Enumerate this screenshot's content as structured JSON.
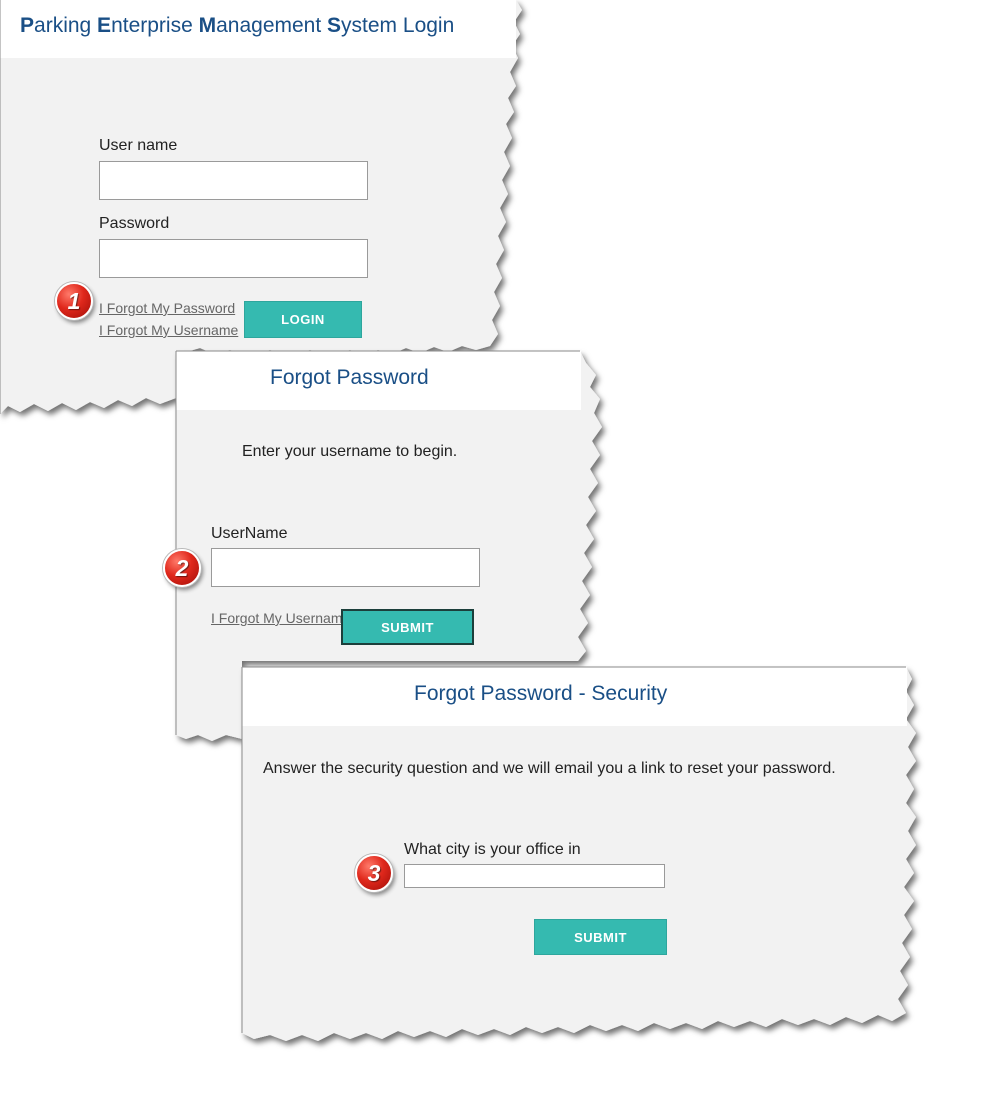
{
  "login_panel": {
    "title_parts": [
      {
        "strong": "P",
        "rest": "arking "
      },
      {
        "strong": "E",
        "rest": "nterprise "
      },
      {
        "strong": "M",
        "rest": "anagement "
      },
      {
        "strong": "S",
        "rest": "ystem Login"
      }
    ],
    "username_label": "User name",
    "username_value": "",
    "password_label": "Password",
    "password_value": "",
    "forgot_password_link": "I Forgot My Password",
    "forgot_username_link": "I Forgot My Username",
    "login_button": "LOGIN",
    "step_badge": "1"
  },
  "forgot_password_panel": {
    "title": "Forgot Password",
    "instructions": "Enter your username to begin.",
    "username_label": "UserName",
    "username_value": "",
    "forgot_username_link": "I Forgot My Usernam",
    "submit_button": "SUBMIT",
    "step_badge": "2"
  },
  "security_panel": {
    "title": "Forgot Password - Security",
    "instructions": "Answer the security question and we will email you a link to reset your password.",
    "question_label": "What city is your office in",
    "answer_value": "",
    "submit_button": "SUBMIT",
    "step_badge": "3"
  },
  "colors": {
    "title_blue": "#1a4f86",
    "button_teal": "#35bab0",
    "panel_body": "#f2f2f2",
    "panel_header": "#ffffff",
    "badge_red": "#e0281c"
  }
}
